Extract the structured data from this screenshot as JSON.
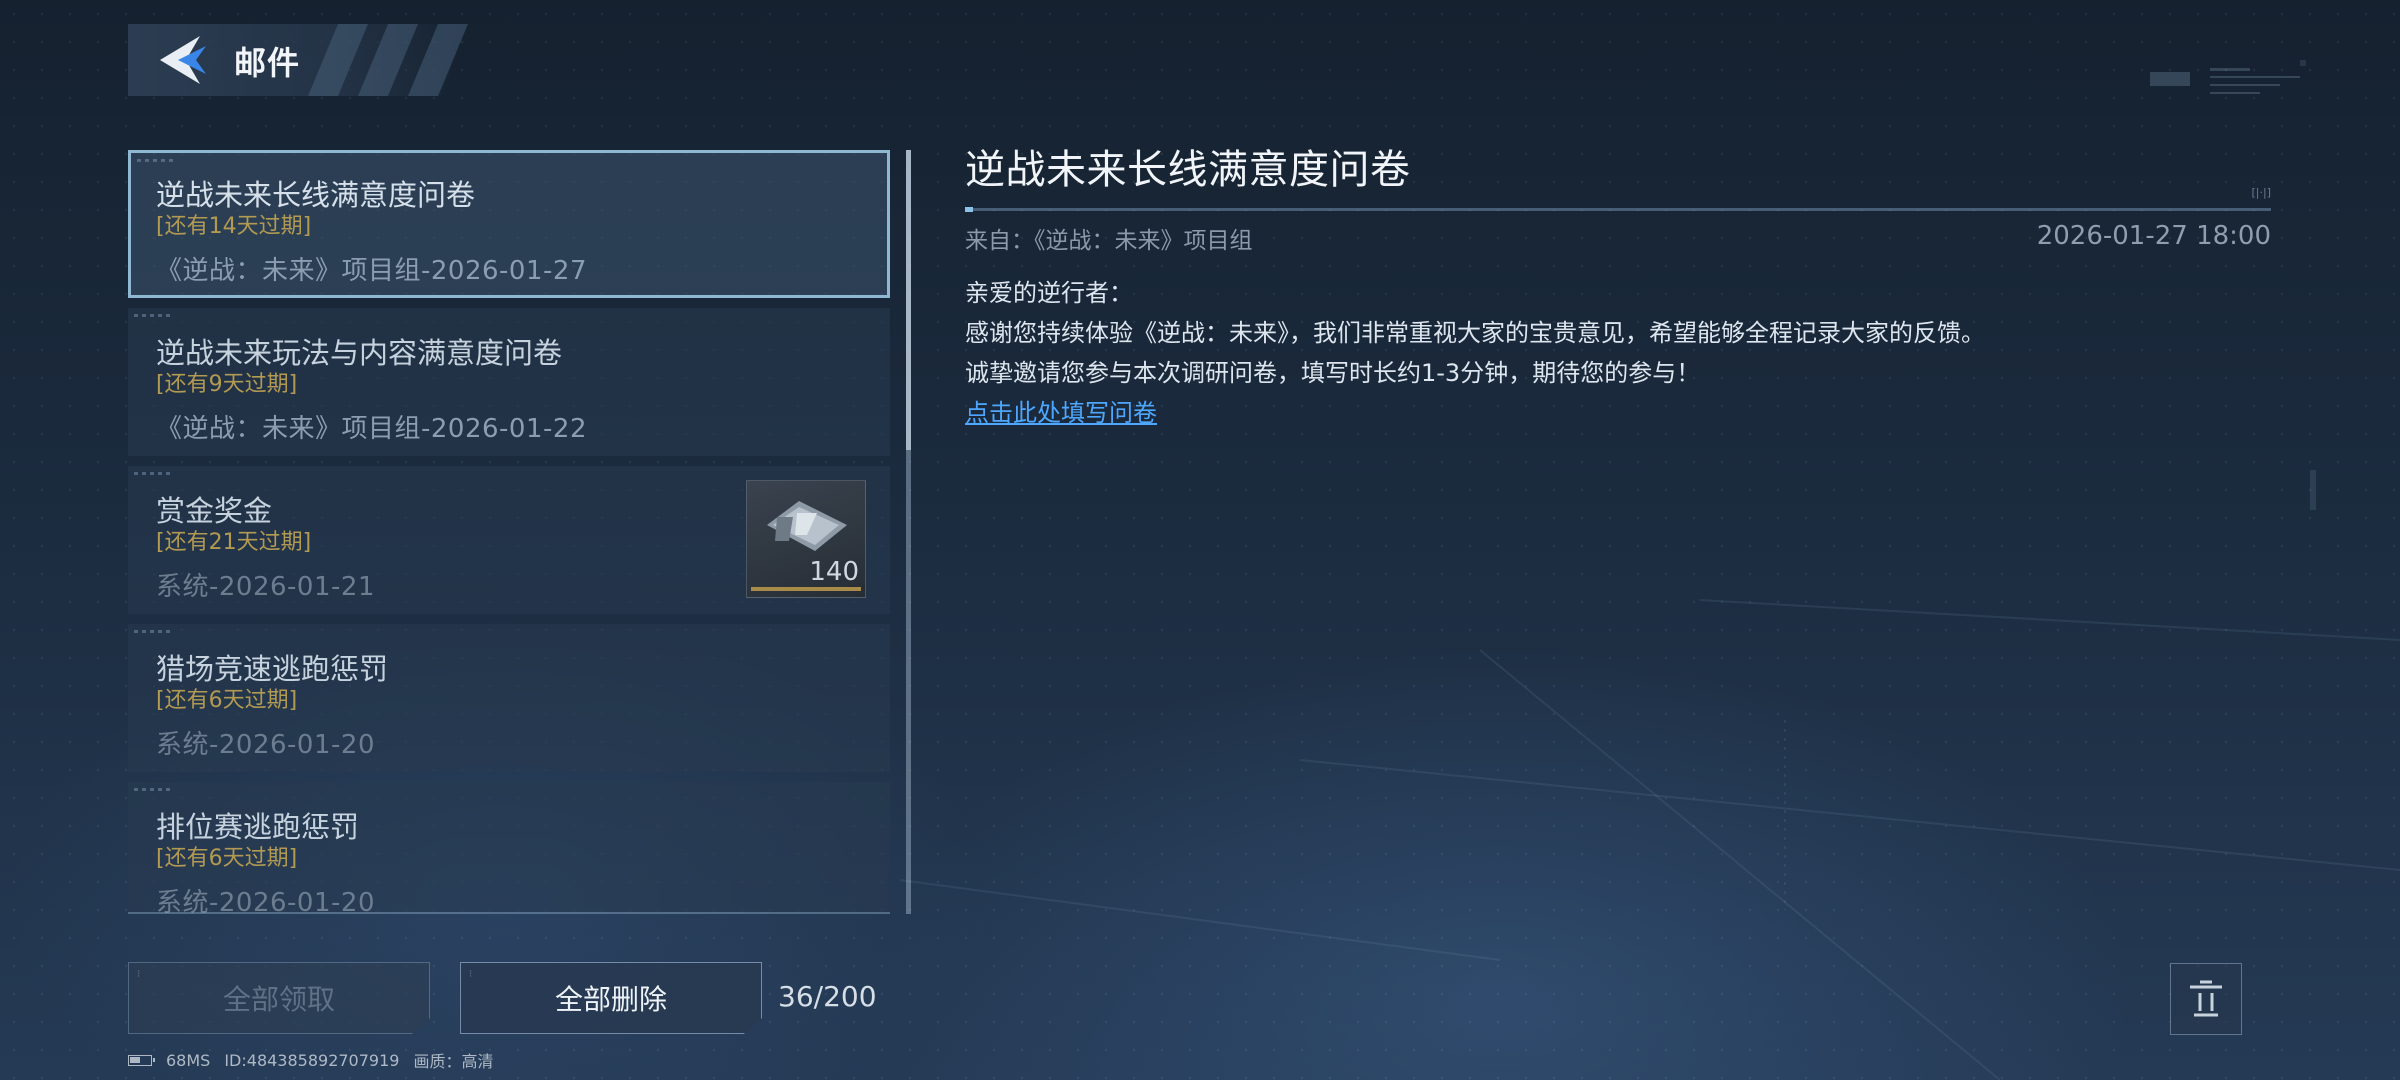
{
  "header": {
    "title": "邮件",
    "back_icon": "back-arrow-icon"
  },
  "mail_list": [
    {
      "title": "逆战未来长线满意度问卷",
      "expiry": "[还有14天过期]",
      "sender": "《逆战：未来》项目组-2026-01-27",
      "selected": true
    },
    {
      "title": "逆战未来玩法与内容满意度问卷",
      "expiry": "[还有9天过期]",
      "sender": "《逆战：未来》项目组-2026-01-22",
      "selected": false
    },
    {
      "title": "赏金奖金",
      "expiry": "[还有21天过期]",
      "sender": "系统-2026-01-21",
      "selected": false,
      "reward": {
        "icon": "currency-ticket-icon",
        "quantity": "140"
      }
    },
    {
      "title": "猎场竞速逃跑惩罚",
      "expiry": "[还有6天过期]",
      "sender": "系统-2026-01-20",
      "selected": false
    },
    {
      "title": "排位赛逃跑惩罚",
      "expiry": "[还有6天过期]",
      "sender": "系统-2026-01-20",
      "selected": false
    }
  ],
  "actions": {
    "claim_all_label": "全部领取",
    "claim_all_enabled": false,
    "delete_all_label": "全部删除",
    "mail_count": "36/200",
    "trash_icon": "trash-icon"
  },
  "status_bar": {
    "ping": "68MS",
    "player_id": "ID:484385892707919",
    "quality": "画质：高清"
  },
  "detail": {
    "title": "逆战未来长线满意度问卷",
    "from": "来自：《逆战：未来》项目组",
    "datetime": "2026-01-27 18:00",
    "greeting": "亲爱的逆行者：",
    "line1": "感谢您持续体验《逆战：未来》，我们非常重视大家的宝贵意见，希望能够全程记录大家的反馈。",
    "line2": "诚挚邀请您参与本次调研问卷，填写时长约1-3分钟，期待您的参与！",
    "link": "点击此处填写问卷"
  },
  "colors": {
    "accent": "#4ea7ff",
    "expiry": "#b39a52",
    "selected_border": "#8fb8d2"
  }
}
